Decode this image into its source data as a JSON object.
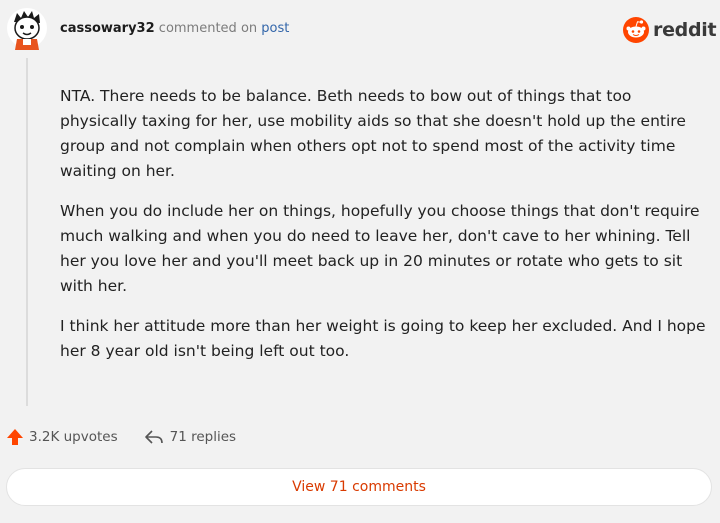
{
  "post": {
    "username": "cassowary32",
    "action_text": "commented on",
    "post_link": "post",
    "brand": "reddit",
    "paragraphs": [
      "NTA. There needs to be balance. Beth needs to bow out of things that too physically taxing for her, use mobility aids so that she doesn't hold up the entire group and not complain when others opt not to spend most of the activity time waiting on her.",
      "When you do include her on things, hopefully you choose things that don't require much walking and when you do need to leave her, don't cave to her whining. Tell her you love her and you'll meet back up in 20 minutes or rotate who gets to sit with her.",
      "I think her attitude more than her weight is going to keep her excluded. And I hope her 8 year old isn't being left out too."
    ]
  },
  "actions": {
    "upvotes": "3.2K upvotes",
    "replies": "71 replies"
  },
  "footer": {
    "view_comments": "View 71 comments"
  },
  "colors": {
    "accent": "#ff4500",
    "link": "#3366aa",
    "button_text": "#d93a00"
  }
}
